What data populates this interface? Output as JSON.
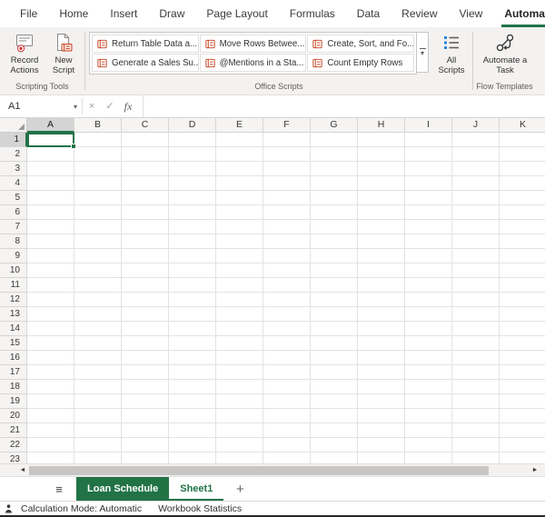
{
  "colors": {
    "excel_green": "#217346",
    "script_icon_orange": "#c43e1c"
  },
  "ribbon_tabs": {
    "items": [
      {
        "label": "File",
        "active": false
      },
      {
        "label": "Home",
        "active": false
      },
      {
        "label": "Insert",
        "active": false
      },
      {
        "label": "Draw",
        "active": false
      },
      {
        "label": "Page Layout",
        "active": false
      },
      {
        "label": "Formulas",
        "active": false
      },
      {
        "label": "Data",
        "active": false
      },
      {
        "label": "Review",
        "active": false
      },
      {
        "label": "View",
        "active": false
      },
      {
        "label": "Automate",
        "active": true
      }
    ]
  },
  "ribbon": {
    "record_actions_label": "Record Actions",
    "new_script_label": "New Script",
    "scripting_group_label": "Scripting Tools",
    "gallery_items": [
      "Return Table Data a...",
      "Move Rows Betwee...",
      "Create, Sort, and Fo...",
      "Generate a Sales Su...",
      "@Mentions in a Sta...",
      "Count Empty Rows"
    ],
    "gallery_more_icon": "▾",
    "all_scripts_label": "All Scripts",
    "office_scripts_group_label": "Office Scripts",
    "automate_task_label": "Automate a Task",
    "flow_group_label": "Flow Templates"
  },
  "formula_bar": {
    "name_box_value": "A1",
    "dropdown_icon": "▾",
    "cancel_glyph": "×",
    "enter_glyph": "✓",
    "fx_glyph": "fx"
  },
  "grid": {
    "columns": [
      "A",
      "B",
      "C",
      "D",
      "E",
      "F",
      "G",
      "H",
      "I",
      "J",
      "K"
    ],
    "visible_row_count": 23,
    "selected_cell": "A1",
    "selected_column": "A",
    "selected_row": 1
  },
  "scrollbar": {
    "left_icon": "◄",
    "right_icon": "►"
  },
  "sheet_bar": {
    "menu_icon": "≡",
    "tabs": [
      {
        "label": "Loan Schedule",
        "style": "colored"
      },
      {
        "label": "Sheet1",
        "style": "active"
      }
    ],
    "add_label": "+"
  },
  "status_bar": {
    "calculation_mode": "Calculation Mode: Automatic",
    "workbook_statistics": "Workbook Statistics"
  }
}
